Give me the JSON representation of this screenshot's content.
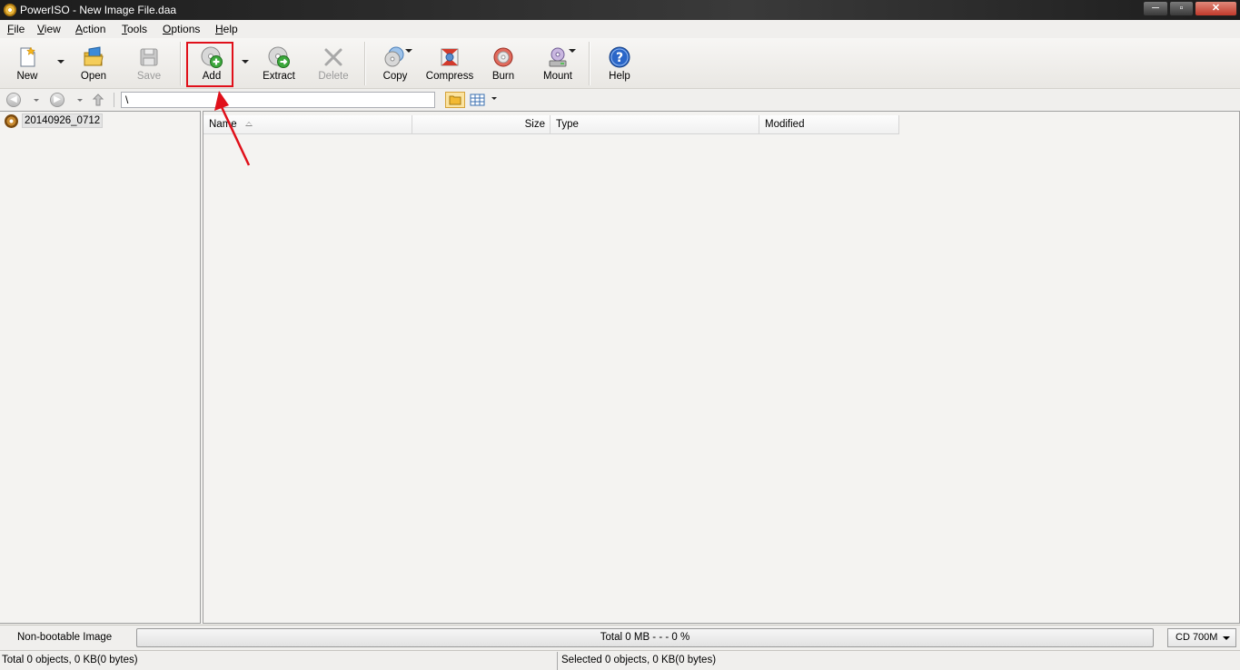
{
  "window": {
    "title": "PowerISO - New Image File.daa",
    "minimize_glyph": "─",
    "maximize_glyph": "▫",
    "close_glyph": "✕"
  },
  "menu": [
    "File",
    "View",
    "Action",
    "Tools",
    "Options",
    "Help"
  ],
  "toolbar": {
    "buttons": [
      {
        "label": "New",
        "icon": "new-file-icon"
      },
      {
        "label": "Open",
        "icon": "open-folder-icon"
      },
      {
        "label": "Save",
        "icon": "save-disk-icon",
        "disabled": true
      },
      {
        "label": "Add",
        "icon": "add-disc-icon"
      },
      {
        "label": "Extract",
        "icon": "extract-disc-icon"
      },
      {
        "label": "Delete",
        "icon": "delete-x-icon",
        "disabled": true
      },
      {
        "label": "Copy",
        "icon": "copy-disc-icon"
      },
      {
        "label": "Compress",
        "icon": "compress-icon"
      },
      {
        "label": "Burn",
        "icon": "burn-disc-icon"
      },
      {
        "label": "Mount",
        "icon": "mount-drive-icon"
      },
      {
        "label": "Help",
        "icon": "help-question-icon"
      }
    ]
  },
  "address": {
    "path": "\\"
  },
  "tree": {
    "root_label": "20140926_0712"
  },
  "file_list": {
    "columns": [
      "Name",
      "Size",
      "Type",
      "Modified"
    ]
  },
  "status": {
    "boot_type": "Non-bootable Image",
    "progress_text": "Total  0 MB   - - -  0 %",
    "media_size": "CD 700M",
    "total_objects": "Total 0 objects, 0 KB(0 bytes)",
    "selected_objects": "Selected 0 objects, 0 KB(0 bytes)"
  },
  "colors": {
    "highlight": "#e0101a",
    "title_bar": "#2a2a2a",
    "close_button": "#c0392b"
  }
}
